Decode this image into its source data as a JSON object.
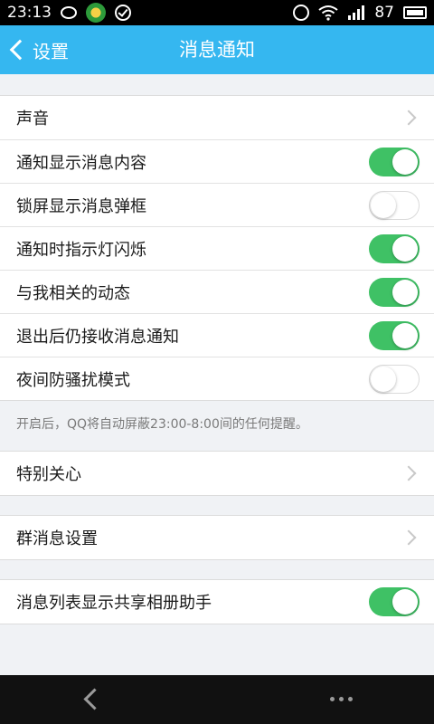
{
  "status_bar": {
    "time": "23:13",
    "battery_percent": "87",
    "icons": [
      "chat-icon",
      "app-icon",
      "check-icon",
      "alarm-icon",
      "wifi-icon",
      "signal-icon",
      "battery-icon"
    ]
  },
  "header": {
    "back_label": "设置",
    "title": "消息通知",
    "background": "#35b7f0"
  },
  "sections": {
    "main": [
      {
        "label": "声音",
        "control": "chevron"
      },
      {
        "label": "通知显示消息内容",
        "control": "toggle",
        "on": true
      },
      {
        "label": "锁屏显示消息弹框",
        "control": "toggle",
        "on": false
      },
      {
        "label": "通知时指示灯闪烁",
        "control": "toggle",
        "on": true
      },
      {
        "label": "与我相关的动态",
        "control": "toggle",
        "on": true
      },
      {
        "label": "退出后仍接收消息通知",
        "control": "toggle",
        "on": true
      },
      {
        "label": "夜间防骚扰模式",
        "control": "toggle",
        "on": false
      }
    ],
    "night_hint": "开启后，QQ将自动屏蔽23:00-8:00间的任何提醒。",
    "special": {
      "label": "特别关心"
    },
    "group": {
      "label": "群消息设置"
    },
    "album": {
      "label": "消息列表显示共享相册助手",
      "on": true
    }
  },
  "colors": {
    "toggle_on": "#3fc165",
    "page_bg": "#f0f2f5"
  }
}
